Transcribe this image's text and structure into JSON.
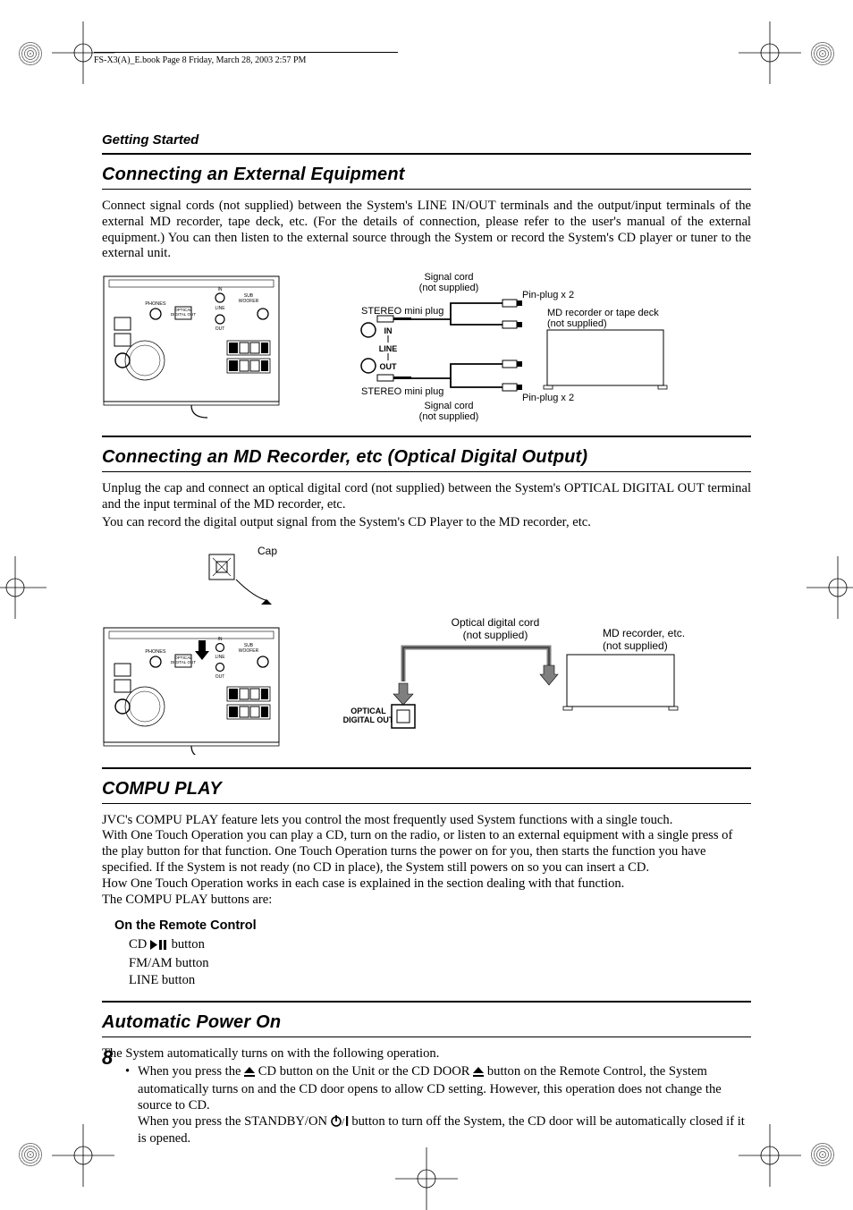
{
  "header": {
    "book_marker": "FS-X3(A)_E.book  Page 8  Friday, March 28, 2003  2:57 PM"
  },
  "page_number": "8",
  "section_label": "Getting Started",
  "sections": {
    "s1": {
      "title": "Connecting an External Equipment",
      "body": "Connect signal cords (not supplied) between the System's LINE IN/OUT terminals and the output/input terminals of the external MD recorder, tape deck, etc. (For the details of connection, please refer to the user's manual of the external equipment.) You can then listen to the external source through the System or record the System's CD player or tuner to the external unit."
    },
    "s2": {
      "title": "Connecting an MD Recorder, etc (Optical Digital Output)",
      "p1": "Unplug the cap and connect an optical digital cord (not supplied) between the System's OPTICAL DIGITAL OUT terminal and the input terminal of the MD recorder, etc.",
      "p2": "You can record the digital output signal from the System's CD Player to the MD recorder, etc."
    },
    "s3": {
      "title": "COMPU PLAY",
      "body": "JVC's COMPU PLAY feature lets you control the most frequently used System functions with a single touch.\nWith One Touch Operation you can play a CD, turn on the radio, or listen to an external equipment with a single press of the play button for that function. One Touch Operation turns the power on for you, then starts the function you have specified. If the System is not ready (no CD in place), the System still powers on so you can insert a CD.\nHow One Touch Operation works in each case is explained in the section dealing with that function.\nThe COMPU PLAY buttons are:",
      "sub": "On the Remote Control",
      "items": {
        "a_pre": "CD ",
        "a_post": " button",
        "b": "FM/AM button",
        "c": "LINE button"
      }
    },
    "s4": {
      "title": "Automatic Power On",
      "lead": "The System automatically turns on with the following operation.",
      "bullet_pre1": "When you press the ",
      "bullet_mid1": " CD button on the Unit or the CD DOOR ",
      "bullet_post1": " button on the Remote Control, the System automatically turns on and the CD door opens to allow CD setting. However, this operation does not change the source to CD.",
      "bullet_pre2": "When you press the STANDBY/ON  ",
      "bullet_post2": " button to turn off the System, the CD door will be automatically closed if it is opened."
    }
  },
  "fig1": {
    "signal_cord": "Signal cord",
    "not_supplied": "(not supplied)",
    "pin_plug": "Pin-plug x 2",
    "stereo_mini": "STEREO mini plug",
    "md_deck": "MD recorder or tape deck",
    "in": "IN",
    "line": "LINE",
    "out": "OUT",
    "phones": "PHONES",
    "optical": "OPTICAL",
    "digital_out": "DIGITAL OUT",
    "sub_woofer": "SUB\nWOOFER"
  },
  "fig2": {
    "cap": "Cap",
    "optical_cord": "Optical digital cord",
    "not_supplied": "(not supplied)",
    "md_etc": "MD recorder, etc.",
    "optical": "OPTICAL",
    "digital_out": "DIGITAL OUT"
  }
}
